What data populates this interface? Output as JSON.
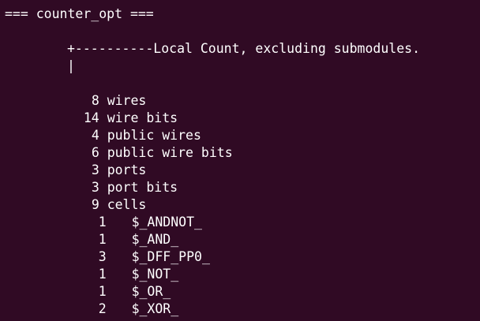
{
  "terminal": {
    "header": "=== counter_opt ===",
    "tree_top": "+----------Local Count, excluding submodules.",
    "tree_bar": "|",
    "stats": [
      {
        "count": "8",
        "label": "wires"
      },
      {
        "count": "14",
        "label": "wire bits"
      },
      {
        "count": "4",
        "label": "public wires"
      },
      {
        "count": "6",
        "label": "public wire bits"
      },
      {
        "count": "3",
        "label": "ports"
      },
      {
        "count": "3",
        "label": "port bits"
      },
      {
        "count": "9",
        "label": "cells"
      }
    ],
    "cells": [
      {
        "count": "1",
        "name": "$_ANDNOT_"
      },
      {
        "count": "1",
        "name": "$_AND_"
      },
      {
        "count": "3",
        "name": "$_DFF_PP0_"
      },
      {
        "count": "1",
        "name": "$_NOT_"
      },
      {
        "count": "1",
        "name": "$_OR_"
      },
      {
        "count": "2",
        "name": "$_XOR_"
      }
    ],
    "colors": {
      "background": "#300a24",
      "text": "#ffffff"
    }
  }
}
